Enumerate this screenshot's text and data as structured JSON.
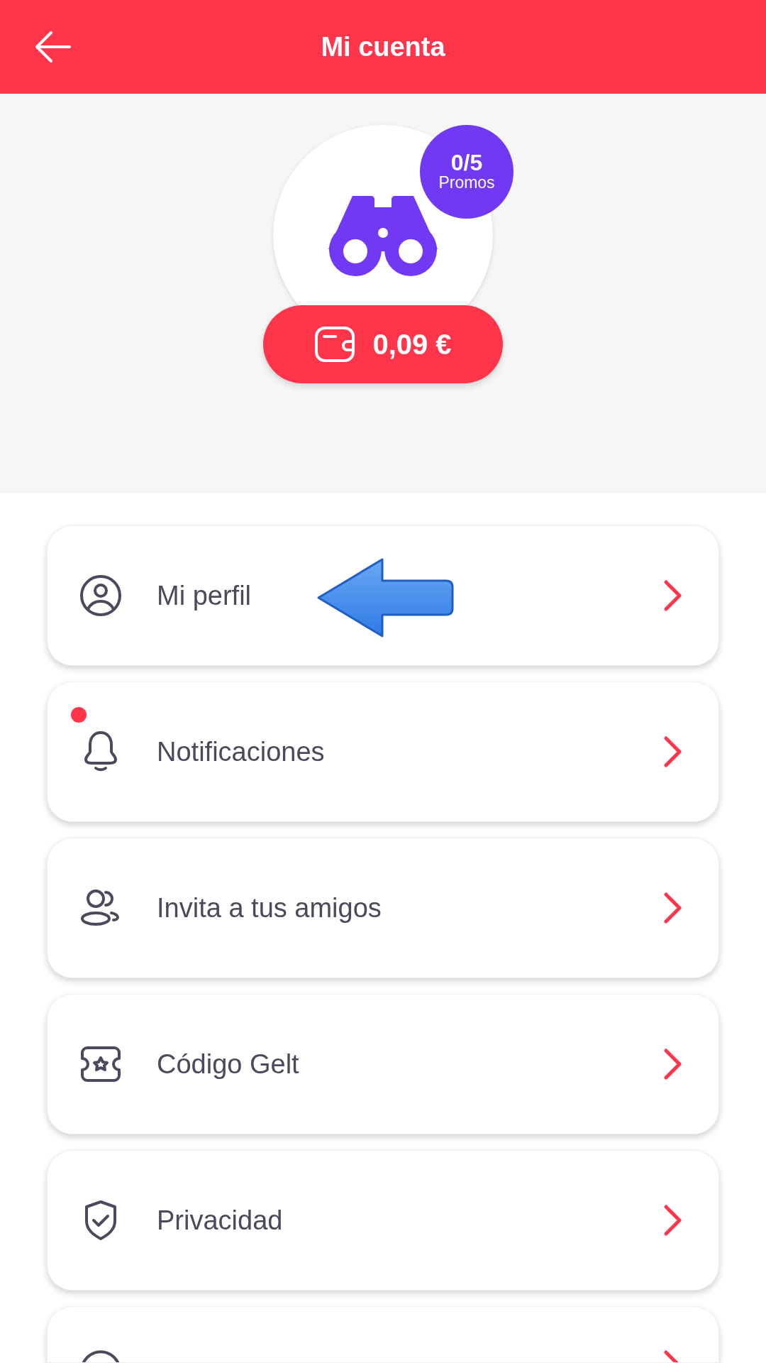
{
  "header": {
    "title": "Mi cuenta"
  },
  "profile": {
    "promos": {
      "count": "0/5",
      "label": "Promos"
    },
    "balance": "0,09 €"
  },
  "menu": [
    {
      "kind": "item",
      "label": "Mi perfil",
      "unread": false,
      "highlighted": true
    },
    {
      "kind": "item",
      "label": "Notificaciones",
      "unread": true,
      "highlighted": false
    },
    {
      "kind": "item",
      "label": "Invita a tus amigos",
      "unread": false,
      "highlighted": false
    },
    {
      "kind": "item",
      "label": "Código Gelt",
      "unread": false,
      "highlighted": false
    },
    {
      "kind": "item",
      "label": "Privacidad",
      "unread": false,
      "highlighted": false
    },
    {
      "kind": "partial"
    }
  ]
}
